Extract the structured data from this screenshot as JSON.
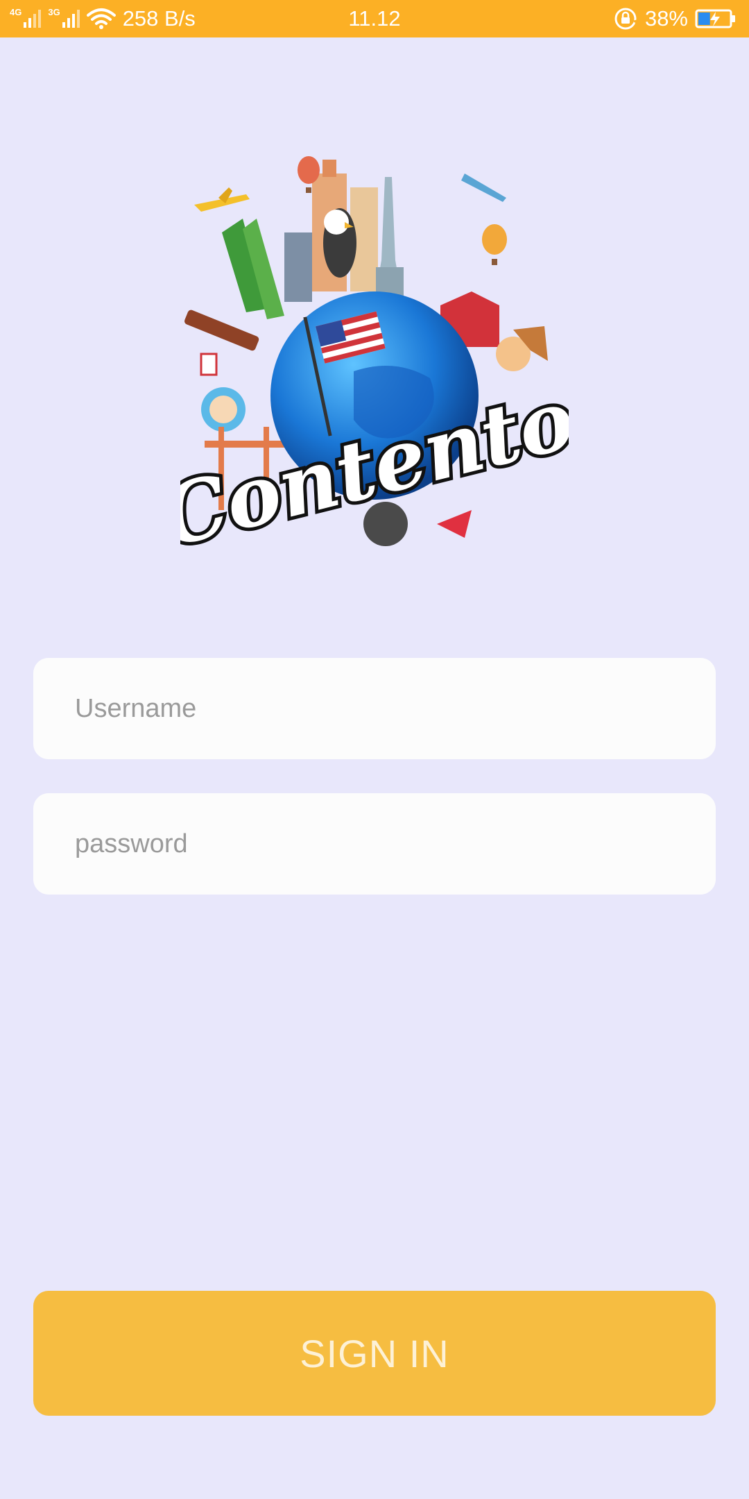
{
  "status_bar": {
    "network_1": "4G",
    "network_2": "3G",
    "data_speed": "258 B/s",
    "time": "11.12",
    "battery_percent": "38%",
    "battery_level": 0.38,
    "background_color": "#fcb025"
  },
  "logo": {
    "wordmark": "Contento"
  },
  "form": {
    "username_placeholder": "Username",
    "username_value": "",
    "password_placeholder": "password",
    "password_value": ""
  },
  "actions": {
    "sign_in_label": "SIGN IN",
    "sign_in_color": "#f6bd41"
  },
  "theme": {
    "background": "#e8e7fb"
  }
}
